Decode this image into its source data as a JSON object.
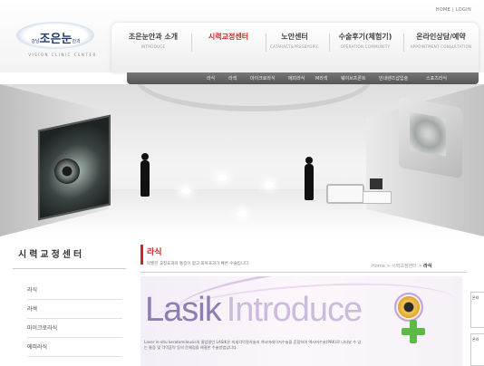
{
  "util": {
    "home": "HOME",
    "login": "LOGIN"
  },
  "logo": {
    "prefix": "강남",
    "name": "조은눈",
    "suffix": "안과",
    "sub": "VISION CLINIC CENTER"
  },
  "gnb": [
    {
      "ko": "조은눈안과 소개",
      "en": "INTRODUCE",
      "active": false
    },
    {
      "ko": "시력교정센터",
      "en": "",
      "active": true
    },
    {
      "ko": "노안센터",
      "en": "CATARACT&PRESBYOPIC",
      "active": false
    },
    {
      "ko": "수술후기(체험기)",
      "en": "OPERATION COMMUNITY",
      "active": false
    },
    {
      "ko": "온라인상담/예약",
      "en": "APPOINTMENT CONSULTATION",
      "active": false
    }
  ],
  "submenu": [
    "라식",
    "라섹",
    "마이크로라식",
    "에피라식",
    "M라섹",
    "웨이브프론트",
    "안내렌즈삽입술",
    "스포츠라식"
  ],
  "left": {
    "title": "시력교정센터",
    "menu": [
      "라식",
      "라섹",
      "마이크로라식",
      "에피라식"
    ]
  },
  "page": {
    "title": "라식",
    "desc": "탁월한 교정효과와 통증이 없고 회복효과가 빠른 수술입니다.",
    "breadcrumb": {
      "home": "Home",
      "sep": ">",
      "section": "시력교정센터",
      "current": "라식"
    }
  },
  "intro": {
    "lasik": "Lasik",
    "introduce": "Introduce",
    "text": "Laser in-situ keratomileusis의 줄임말인 LASIK은 미세각막절삭술과 엑시머레이저수술을 혼합하여 엑시머수술(PRK)로 나타날 수 있는 통증 및 각막혼탁 등의 문제점을 해결한 수술방법입니다."
  },
  "side": {
    "box1": "온라",
    "box2": "온라"
  }
}
